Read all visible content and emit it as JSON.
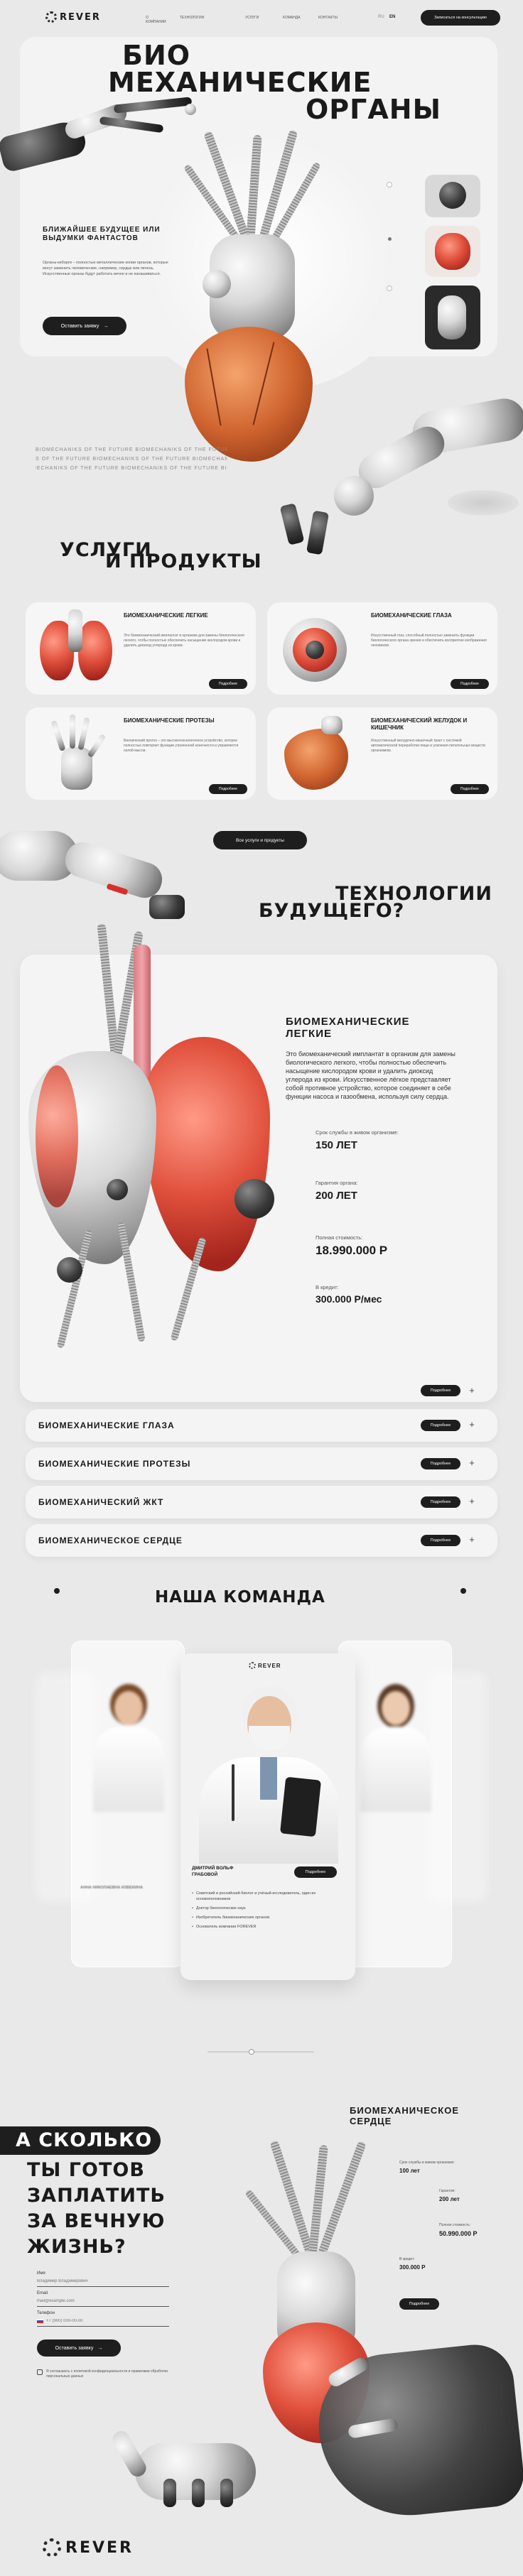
{
  "header": {
    "logo_text": "REVER",
    "nav": [
      "О КОМПАНИИ",
      "ТЕХНОЛОГИИ",
      "УСЛУГИ",
      "КОМАНДА",
      "КОНТАКТЫ"
    ],
    "lang_ru": "RU",
    "lang_en": "EN",
    "cta": "Записаться на консультацию"
  },
  "hero": {
    "title_line1": "БИО",
    "title_line2": "МЕХАНИЧЕСКИЕ",
    "title_line3": "ОРГАНЫ",
    "subtitle": "БЛИЖАЙШЕЕ БУДУЩЕЕ ИЛИ ВЫДУМКИ ФАНТАСТОВ",
    "body": "Органы-киборги – полностью металлические копии органов, которые могут заменить человеческие, например, сердце или печень. Искусственные органы будут работать вечно и не изнашиваться.",
    "cta": "Оставить заявку",
    "marquee": "BIOMECHANIKS OF THE FUTURE  BIOMECHANIKS OF THE FUTURE  BIOMECHANIKS OF THE FUTURE"
  },
  "services": {
    "title_line1": "УСЛУГИ",
    "title_line2": "И ПРОДУКТЫ",
    "cards": [
      {
        "title": "БИОМЕХАНИЧЕСКИЕ ЛЕГКИЕ",
        "text": "Это биомеханический имплантат в организм для замены биологического легкого, чтобы полностью обеспечить насыщение кислородом крови и удалить диоксид углерода из крови.",
        "button": "Подробнее"
      },
      {
        "title": "БИОМЕХАНИЧЕСКИЕ ГЛАЗА",
        "text": "Искусственный глаз, способный полностью заменить функции биологического органа зрения и обеспечить восприятие изображения человеком.",
        "button": "Подробнее"
      },
      {
        "title": "БИОМЕХАНИЧЕСКИЕ ПРОТЕЗЫ",
        "text": "Бионический протез – это высокотехнологичное устройство, которое полностью повторяет функции утраченной конечности и управляется силой мысли.",
        "button": "Подробнее"
      },
      {
        "title": "БИОМЕХАНИЧЕСКИЙ ЖЕЛУДОК И КИШЕЧНИК",
        "text": "Искусственный желудочно-кишечный тракт с системой автоматической переработки пищи и усвоения питательных веществ организмом.",
        "button": "Подробнее"
      }
    ],
    "all_button": "Все услуги и продукты"
  },
  "tech": {
    "title_line1": "ТЕХНОЛОГИИ",
    "title_line2": "БУДУЩЕГО?",
    "feature": {
      "title": "БИОМЕХАНИЧЕСКИЕ ЛЕГКИЕ",
      "text": "Это биомеханический имплантат в организм для замены биологического легкого, чтобы полностью обеспечить насыщение кислородом крови и удалить диоксид углерода из крови. Искусственное лёгкое представляет собой противное устройство, которое соединяет в себе функции насоса и газообмена, используя силу сердца.",
      "life_label": "Срок службы в живом организме:",
      "life_value": "150 ЛЕТ",
      "warranty_label": "Гарантия органа:",
      "warranty_value": "200 ЛЕТ",
      "price_label": "Полная стоимость:",
      "price_value": "18.990.000 Р",
      "credit_label": "В кредит:",
      "credit_value": "300.000 Р/мес",
      "button": "Подробнее"
    },
    "accordion": [
      {
        "title": "БИОМЕХАНИЧЕСКИЕ ГЛАЗА",
        "button": "Подробнее"
      },
      {
        "title": "БИОМЕХАНИЧЕСКИЕ ПРОТЕЗЫ",
        "button": "Подробнее"
      },
      {
        "title": "БИОМЕХАНИЧЕСКИЙ ЖКТ",
        "button": "Подробнее"
      },
      {
        "title": "БИОМЕХАНИЧЕСКОЕ СЕРДЦЕ",
        "button": "Подробнее"
      }
    ]
  },
  "team": {
    "title": "НАША КОМАНДА",
    "logo_text": "REVER",
    "left_name": "АННА НИКОЛАЕВНА ИЗВЕКИНА",
    "center_name": "ДМИТРИЙ ВОЛЬФ ГРАБОВОЙ",
    "center_bullets": [
      "Советский и российский биолог и учёный-исследователь, один из основоположников",
      "Доктор биологических наук",
      "Изобретатель биомеханических органов",
      "Основатель компании FOREVER"
    ],
    "card_button": "Подробнее"
  },
  "order": {
    "question_line1": "А СКОЛЬКО",
    "question_line2": "ТЫ ГОТОВ",
    "question_line3": "ЗАПЛАТИТЬ",
    "question_line4": "ЗА ВЕЧНУЮ",
    "question_line5": "ЖИЗНЬ?",
    "name_label": "Имя",
    "name_placeholder": "Владимир Владимирович",
    "email_label": "Email",
    "email_placeholder": "mail@example.com",
    "phone_label": "Телефон",
    "phone_placeholder": "+7 (900) 000-00-00",
    "submit": "Оставить заявку",
    "consent": "Я соглашаюсь с политикой конфиденциальности и правилами обработки персональных данных",
    "product_title": "БИОМЕХАНИЧЕСКОЕ СЕРДЦЕ",
    "life_label": "Срок службы в живом организме:",
    "life_value": "100 лет",
    "warranty_label": "Гарантия:",
    "warranty_value": "200 лет",
    "price_label": "Полная стоимость:",
    "price_value": "50.990.000 Р",
    "credit_label": "В кредит:",
    "credit_value": "300.000 Р",
    "button": "Подробнее"
  },
  "footer": {
    "logo_text": "REVER"
  }
}
